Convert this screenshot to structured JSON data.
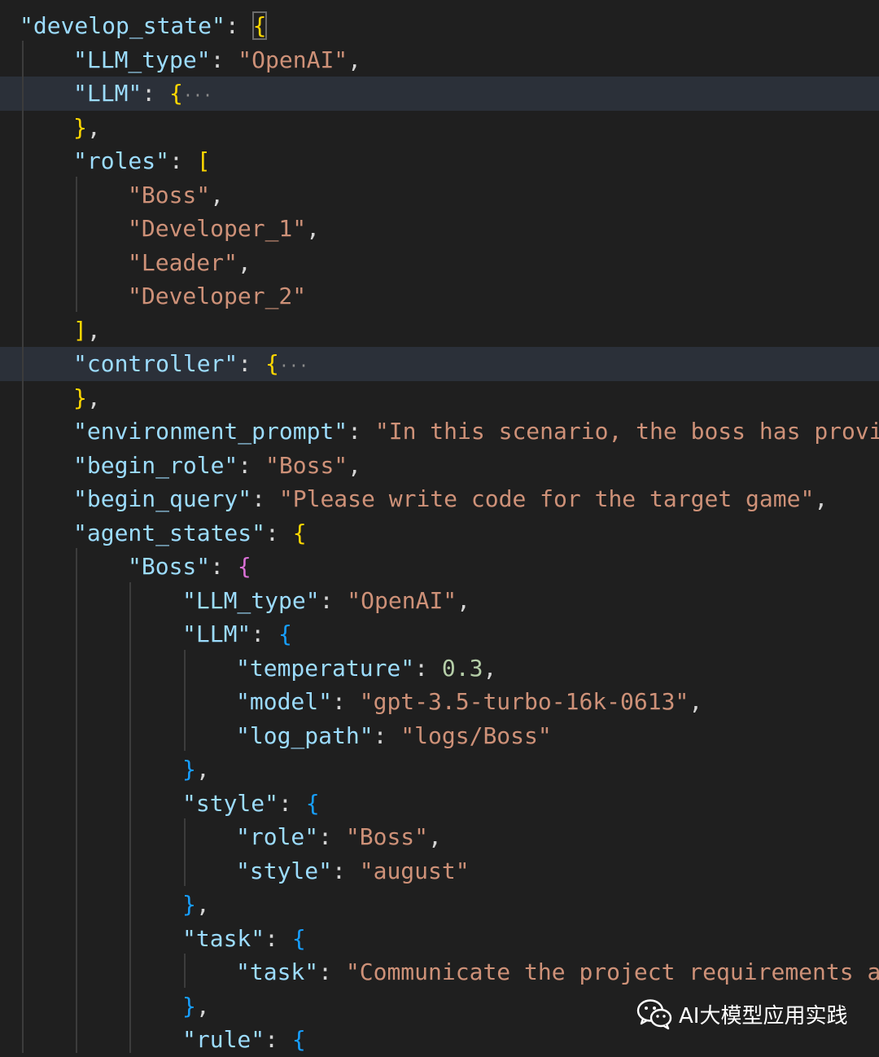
{
  "editor": {
    "lines": [
      {
        "tokens": [
          {
            "t": "\"develop_state\"",
            "c": "k"
          },
          {
            "t": ": ",
            "c": "p"
          },
          {
            "t": "{",
            "c": "b1",
            "cursor": true
          }
        ]
      },
      {
        "tokens": [
          {
            "t": "\"LLM_type\"",
            "c": "k"
          },
          {
            "t": ": ",
            "c": "p"
          },
          {
            "t": "\"OpenAI\"",
            "c": "s"
          },
          {
            "t": ",",
            "c": "p"
          }
        ]
      },
      {
        "highlight": true,
        "tokens": [
          {
            "t": "\"LLM\"",
            "c": "k"
          },
          {
            "t": ": ",
            "c": "p"
          },
          {
            "t": "{",
            "c": "b1"
          },
          {
            "t": "···",
            "c": "fold"
          }
        ]
      },
      {
        "tokens": [
          {
            "t": "}",
            "c": "b1"
          },
          {
            "t": ",",
            "c": "p"
          }
        ]
      },
      {
        "tokens": [
          {
            "t": "\"roles\"",
            "c": "k"
          },
          {
            "t": ": ",
            "c": "p"
          },
          {
            "t": "[",
            "c": "b1"
          }
        ]
      },
      {
        "tokens": [
          {
            "t": "\"Boss\"",
            "c": "s"
          },
          {
            "t": ",",
            "c": "p"
          }
        ]
      },
      {
        "tokens": [
          {
            "t": "\"Developer_1\"",
            "c": "s"
          },
          {
            "t": ",",
            "c": "p"
          }
        ]
      },
      {
        "tokens": [
          {
            "t": "\"Leader\"",
            "c": "s"
          },
          {
            "t": ",",
            "c": "p"
          }
        ]
      },
      {
        "tokens": [
          {
            "t": "\"Developer_2\"",
            "c": "s"
          }
        ]
      },
      {
        "tokens": [
          {
            "t": "]",
            "c": "b1"
          },
          {
            "t": ",",
            "c": "p"
          }
        ]
      },
      {
        "highlight": true,
        "tokens": [
          {
            "t": "\"controller\"",
            "c": "k"
          },
          {
            "t": ": ",
            "c": "p"
          },
          {
            "t": "{",
            "c": "b1"
          },
          {
            "t": "···",
            "c": "fold"
          }
        ]
      },
      {
        "tokens": [
          {
            "t": "}",
            "c": "b1"
          },
          {
            "t": ",",
            "c": "p"
          }
        ]
      },
      {
        "tokens": [
          {
            "t": "\"environment_prompt\"",
            "c": "k"
          },
          {
            "t": ": ",
            "c": "p"
          },
          {
            "t": "\"In this scenario, the boss has provid",
            "c": "s"
          }
        ]
      },
      {
        "tokens": [
          {
            "t": "\"begin_role\"",
            "c": "k"
          },
          {
            "t": ": ",
            "c": "p"
          },
          {
            "t": "\"Boss\"",
            "c": "s"
          },
          {
            "t": ",",
            "c": "p"
          }
        ]
      },
      {
        "tokens": [
          {
            "t": "\"begin_query\"",
            "c": "k"
          },
          {
            "t": ": ",
            "c": "p"
          },
          {
            "t": "\"Please write code for the target game\"",
            "c": "s"
          },
          {
            "t": ",",
            "c": "p"
          }
        ]
      },
      {
        "tokens": [
          {
            "t": "\"agent_states\"",
            "c": "k"
          },
          {
            "t": ": ",
            "c": "p"
          },
          {
            "t": "{",
            "c": "b1"
          }
        ]
      },
      {
        "tokens": [
          {
            "t": "\"Boss\"",
            "c": "k"
          },
          {
            "t": ": ",
            "c": "p"
          },
          {
            "t": "{",
            "c": "b2"
          }
        ]
      },
      {
        "tokens": [
          {
            "t": "\"LLM_type\"",
            "c": "k"
          },
          {
            "t": ": ",
            "c": "p"
          },
          {
            "t": "\"OpenAI\"",
            "c": "s"
          },
          {
            "t": ",",
            "c": "p"
          }
        ]
      },
      {
        "tokens": [
          {
            "t": "\"LLM\"",
            "c": "k"
          },
          {
            "t": ": ",
            "c": "p"
          },
          {
            "t": "{",
            "c": "b3"
          }
        ]
      },
      {
        "tokens": [
          {
            "t": "\"temperature\"",
            "c": "k"
          },
          {
            "t": ": ",
            "c": "p"
          },
          {
            "t": "0.3",
            "c": "n"
          },
          {
            "t": ",",
            "c": "p"
          }
        ]
      },
      {
        "tokens": [
          {
            "t": "\"model\"",
            "c": "k"
          },
          {
            "t": ": ",
            "c": "p"
          },
          {
            "t": "\"gpt-3.5-turbo-16k-0613\"",
            "c": "s"
          },
          {
            "t": ",",
            "c": "p"
          }
        ]
      },
      {
        "tokens": [
          {
            "t": "\"log_path\"",
            "c": "k"
          },
          {
            "t": ": ",
            "c": "p"
          },
          {
            "t": "\"logs/Boss\"",
            "c": "s"
          }
        ]
      },
      {
        "tokens": [
          {
            "t": "}",
            "c": "b3"
          },
          {
            "t": ",",
            "c": "p"
          }
        ]
      },
      {
        "tokens": [
          {
            "t": "\"style\"",
            "c": "k"
          },
          {
            "t": ": ",
            "c": "p"
          },
          {
            "t": "{",
            "c": "b3"
          }
        ]
      },
      {
        "tokens": [
          {
            "t": "\"role\"",
            "c": "k"
          },
          {
            "t": ": ",
            "c": "p"
          },
          {
            "t": "\"Boss\"",
            "c": "s"
          },
          {
            "t": ",",
            "c": "p"
          }
        ]
      },
      {
        "tokens": [
          {
            "t": "\"style\"",
            "c": "k"
          },
          {
            "t": ": ",
            "c": "p"
          },
          {
            "t": "\"august\"",
            "c": "s"
          }
        ]
      },
      {
        "tokens": [
          {
            "t": "}",
            "c": "b3"
          },
          {
            "t": ",",
            "c": "p"
          }
        ]
      },
      {
        "tokens": [
          {
            "t": "\"task\"",
            "c": "k"
          },
          {
            "t": ": ",
            "c": "p"
          },
          {
            "t": "{",
            "c": "b3"
          }
        ]
      },
      {
        "tokens": [
          {
            "t": "\"task\"",
            "c": "k"
          },
          {
            "t": ": ",
            "c": "p"
          },
          {
            "t": "\"Communicate the project requirements an",
            "c": "s"
          }
        ]
      },
      {
        "tokens": [
          {
            "t": "}",
            "c": "b3"
          },
          {
            "t": ",",
            "c": "p"
          }
        ]
      },
      {
        "tokens": [
          {
            "t": "\"rule\"",
            "c": "k"
          },
          {
            "t": ": ",
            "c": "p"
          },
          {
            "t": "{",
            "c": "b3"
          }
        ]
      }
    ]
  },
  "watermark": {
    "text": "AI大模型应用实践",
    "icon": "wechat-icon"
  },
  "colors": {
    "background": "#1f1f1f",
    "key": "#9cdcfe",
    "string": "#ce9178",
    "number": "#b5cea8",
    "bracket_gold": "#ffd700",
    "bracket_orchid": "#da70d6",
    "bracket_blue": "#179fff"
  }
}
